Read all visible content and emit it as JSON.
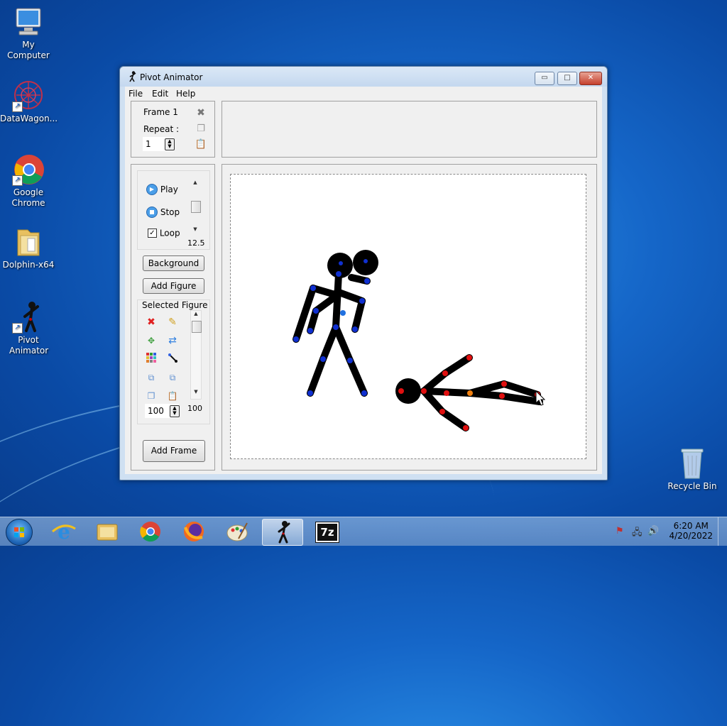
{
  "desktop": {
    "icons": [
      {
        "label": "My Computer"
      },
      {
        "label": "DataWagon..."
      },
      {
        "label": "Google Chrome"
      },
      {
        "label": "Dolphin-x64"
      },
      {
        "label": "Pivot Animator"
      },
      {
        "label": "Recycle Bin"
      }
    ]
  },
  "window": {
    "title": "Pivot Animator",
    "buttons": {
      "minimize": "▭",
      "maximize": "□",
      "close": "✕"
    },
    "menu": [
      "File",
      "Edit",
      "Help"
    ],
    "frame_panel": {
      "frame_label": "Frame 1",
      "repeat_label": "Repeat :",
      "repeat_value": "1"
    },
    "playback": {
      "play_label": "Play",
      "stop_label": "Stop",
      "loop_label": "Loop",
      "loop_checked": true,
      "speed_value": "12.5"
    },
    "background_button": "Background",
    "add_figure_button": "Add Figure",
    "selected_figure": {
      "heading": "Selected Figure",
      "scale_value": "100",
      "scale_readout": "100"
    },
    "add_frame_button": "Add Frame"
  },
  "taskbar": {
    "clock_time": "6:20 AM",
    "clock_date": "4/20/2022",
    "pinned": [
      "start-orb",
      "internet-explorer-icon",
      "file-explorer-icon",
      "chrome-icon",
      "firefox-icon",
      "paint-icon",
      "pivot-animator-icon",
      "7zip-icon"
    ],
    "seven_zip_label": "7z"
  },
  "colors": {
    "figure_joint_blue": "#1030d0",
    "figure_joint_red": "#e01010",
    "figure_joint_orange": "#f08010",
    "figure_body": "#000000"
  }
}
